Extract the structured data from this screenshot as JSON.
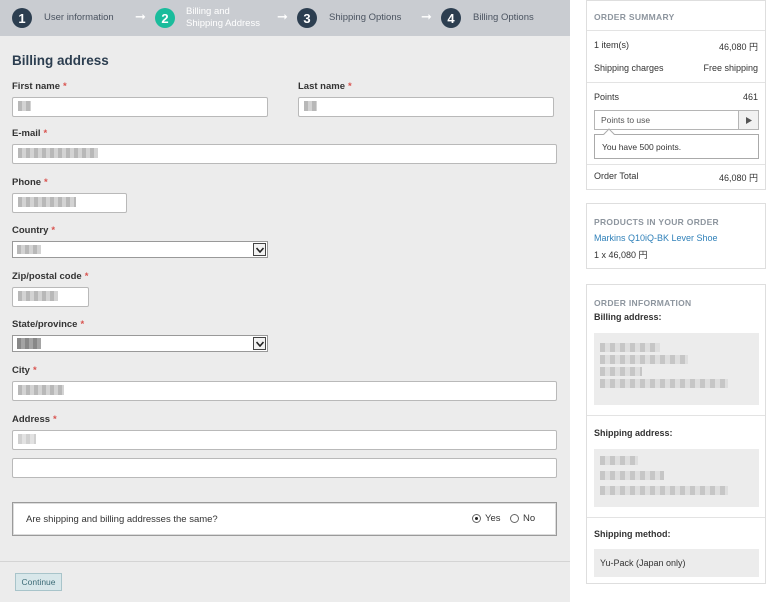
{
  "steps": [
    {
      "num": "1",
      "label": "User information"
    },
    {
      "num": "2",
      "label_line1": "Billing and",
      "label_line2": "Shipping Address"
    },
    {
      "num": "3",
      "label": "Shipping Options"
    },
    {
      "num": "4",
      "label": "Billing Options"
    }
  ],
  "arrow_glyph": "➞",
  "form": {
    "title": "Billing address",
    "required_mark": "*",
    "first_name_label": "First name",
    "last_name_label": "Last name",
    "email_label": "E-mail",
    "phone_label": "Phone",
    "country_label": "Country",
    "zip_label": "Zip/postal code",
    "state_label": "State/province",
    "city_label": "City",
    "address_label": "Address",
    "same_question": "Are shipping and billing addresses the same?",
    "yes_label": "Yes",
    "no_label": "No",
    "yes_selected": true,
    "continue_label": "Continue"
  },
  "summary": {
    "title": "ORDER SUMMARY",
    "items_label": "1 item(s)",
    "items_value": "46,080 円",
    "shipping_label": "Shipping charges",
    "shipping_value": "Free shipping",
    "points_label": "Points",
    "points_value": "461",
    "points_placeholder": "Points to use",
    "points_tip": "You have 500 points.",
    "total_label": "Order Total",
    "total_value": "46,080 円"
  },
  "products": {
    "title": "PRODUCTS IN YOUR ORDER",
    "product_name": "Markins Q10iQ-BK Lever Shoe",
    "product_qty": "1 x 46,080 円"
  },
  "order_info": {
    "title": "ORDER INFORMATION",
    "billing_label": "Billing address:",
    "shipping_label": "Shipping address:",
    "method_label": "Shipping method:",
    "method_value": "Yu-Pack (Japan only)"
  },
  "colors": {
    "accent": "#1abc9c",
    "step_dark": "#2c3e50",
    "link": "#2f80b9",
    "required": "#d9534f"
  }
}
